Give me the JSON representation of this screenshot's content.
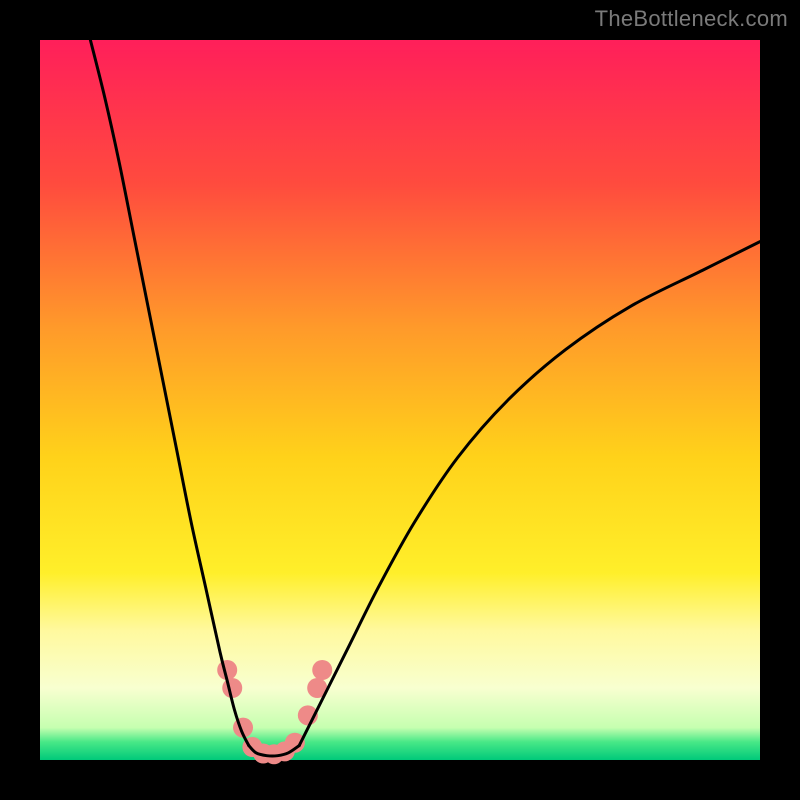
{
  "watermark": "TheBottleneck.com",
  "chart_data": {
    "type": "line",
    "title": "",
    "xlabel": "",
    "ylabel": "",
    "xlim": [
      0,
      100
    ],
    "ylim": [
      0,
      100
    ],
    "gradient_stops": [
      {
        "pos": 0.0,
        "color": "#ff1f5a"
      },
      {
        "pos": 0.2,
        "color": "#ff4b3e"
      },
      {
        "pos": 0.4,
        "color": "#ff9a2a"
      },
      {
        "pos": 0.58,
        "color": "#ffd21a"
      },
      {
        "pos": 0.74,
        "color": "#ffef2a"
      },
      {
        "pos": 0.82,
        "color": "#fff99e"
      },
      {
        "pos": 0.9,
        "color": "#f8ffd0"
      },
      {
        "pos": 0.955,
        "color": "#c6ffb0"
      },
      {
        "pos": 0.975,
        "color": "#48e887"
      },
      {
        "pos": 1.0,
        "color": "#00c97a"
      }
    ],
    "series": [
      {
        "name": "left-branch",
        "x": [
          7,
          9,
          11,
          13,
          15,
          17,
          19,
          21,
          23,
          25,
          26,
          27,
          28,
          29
        ],
        "y": [
          100,
          92,
          83,
          73,
          63,
          53,
          43,
          33,
          24,
          15,
          11,
          7,
          4,
          2
        ]
      },
      {
        "name": "right-branch",
        "x": [
          36,
          37,
          38,
          40,
          43,
          47,
          52,
          58,
          65,
          73,
          82,
          92,
          100
        ],
        "y": [
          2,
          4,
          6,
          10,
          16,
          24,
          33,
          42,
          50,
          57,
          63,
          68,
          72
        ]
      },
      {
        "name": "valley-floor",
        "x": [
          29,
          30,
          31.5,
          33,
          34.5,
          36
        ],
        "y": [
          2,
          1,
          0.6,
          0.6,
          1,
          2
        ]
      }
    ],
    "markers": {
      "name": "salmon-dots",
      "color": "#ee8a88",
      "radius_px": 10,
      "points": [
        {
          "x": 26.0,
          "y": 12.5
        },
        {
          "x": 26.7,
          "y": 10.0
        },
        {
          "x": 28.2,
          "y": 4.5
        },
        {
          "x": 29.5,
          "y": 1.8
        },
        {
          "x": 31.0,
          "y": 0.9
        },
        {
          "x": 32.5,
          "y": 0.8
        },
        {
          "x": 34.0,
          "y": 1.2
        },
        {
          "x": 35.4,
          "y": 2.4
        },
        {
          "x": 37.2,
          "y": 6.2
        },
        {
          "x": 38.5,
          "y": 10.0
        },
        {
          "x": 39.2,
          "y": 12.5
        }
      ]
    }
  }
}
